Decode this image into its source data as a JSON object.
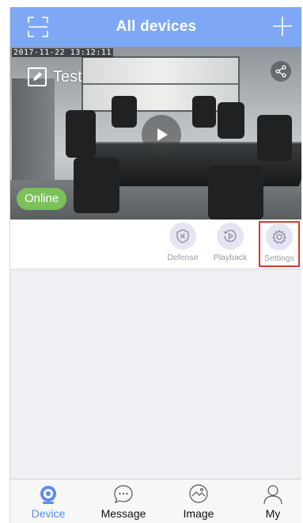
{
  "header": {
    "title": "All devices",
    "scan_icon": "scan-icon",
    "add_icon": "plus-icon"
  },
  "device": {
    "name": "Test",
    "timestamp": "2017-11-22  13:12:11",
    "status": "Online",
    "status_color": "#7cc05a"
  },
  "actions": [
    {
      "label": "Defense",
      "icon": "shield-icon"
    },
    {
      "label": "Playback",
      "icon": "playback-icon"
    },
    {
      "label": "Settings",
      "icon": "gear-icon"
    }
  ],
  "tabs": [
    {
      "label": "Device",
      "icon": "camera-icon",
      "active": true
    },
    {
      "label": "Message",
      "icon": "message-icon",
      "active": false
    },
    {
      "label": "Image",
      "icon": "image-icon",
      "active": false
    },
    {
      "label": "My",
      "icon": "user-icon",
      "active": false
    }
  ],
  "colors": {
    "accent": "#7ea8f6",
    "active_tab": "#5b8def",
    "highlight": "#e0362c"
  }
}
